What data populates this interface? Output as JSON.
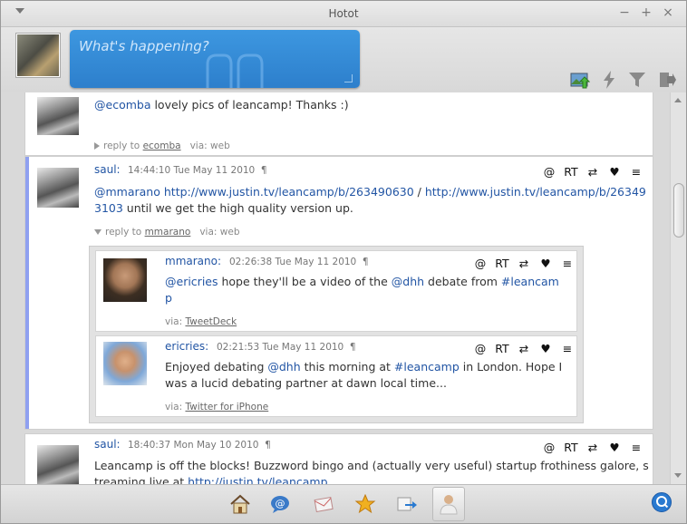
{
  "window": {
    "title": "Hotot"
  },
  "compose": {
    "placeholder": "What's happening?"
  },
  "header_icons": [
    "upload-image-icon",
    "flash-icon",
    "filter-icon",
    "exit-icon"
  ],
  "tweets": [
    {
      "text_mention": "@ecomba",
      "text_rest": " lovely pics of leancamp! Thanks :)",
      "reply_prefix": "reply to",
      "reply_to": "ecomba",
      "via_prefix": "via:",
      "via": "web"
    },
    {
      "user": "saul:",
      "time": "14:44:10 Tue May 11 2010",
      "pilcrow": "¶",
      "mention": "@mmarano",
      "link1": "http://www.justin.tv/leancamp/b/263490630",
      "sep": " / ",
      "link2": "http://www.justin.tv/leancamp/b/263493103",
      "rest": " until we get the high quality version up.",
      "reply_prefix": "reply to",
      "reply_to": "mmarano",
      "via_prefix": "via:",
      "via": "web",
      "actions": [
        "@",
        "RT",
        "⇄",
        "♥",
        "≡"
      ]
    },
    {
      "user": "mmarano:",
      "time": "02:26:38 Tue May 11 2010",
      "pilcrow": "¶",
      "mention1": "@ericries",
      "t1": " hope they'll be a video of the ",
      "mention2": "@dhh",
      "t2": " debate from ",
      "hashtag": "#leancamp",
      "via_prefix": "via:",
      "via": "TweetDeck",
      "actions": [
        "@",
        "RT",
        "⇄",
        "♥",
        "≡"
      ]
    },
    {
      "user": "ericries:",
      "time": "02:21:53 Tue May 11 2010",
      "pilcrow": "¶",
      "t1": "Enjoyed debating ",
      "mention": "@dhh",
      "t2": " this morning at ",
      "hashtag": "#leancamp",
      "t3": " in London. Hope I was a lucid debating partner at dawn local time...",
      "via_prefix": "via:",
      "via": "Twitter for iPhone",
      "actions": [
        "@",
        "RT",
        "⇄",
        "♥",
        "≡"
      ]
    },
    {
      "user": "saul:",
      "time": "18:40:37 Mon May 10 2010",
      "pilcrow": "¶",
      "text": "Leancamp is off the blocks! Buzzword bingo and (actually very useful) startup frothiness galore, streaming live at ",
      "link": "http://justin.tv/leancamp",
      "actions": [
        "@",
        "RT",
        "⇄",
        "♥",
        "≡"
      ]
    }
  ],
  "toolbar": {
    "items": [
      "home-icon",
      "mentions-icon",
      "messages-icon",
      "favorites-icon",
      "retweets-icon",
      "user-icon"
    ],
    "search": "search-icon"
  }
}
